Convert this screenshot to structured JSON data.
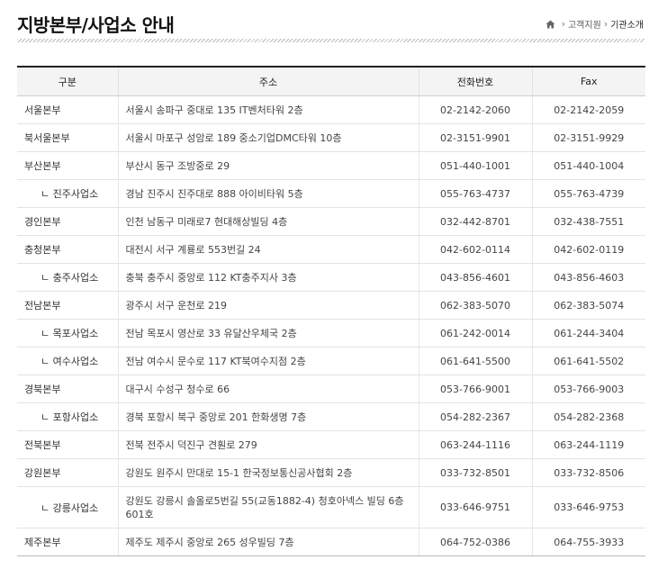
{
  "page_title": "지방본부/사업소 안내",
  "breadcrumb": {
    "home_icon": "home-icon",
    "items": [
      "고객지원",
      "기관소개"
    ]
  },
  "table": {
    "headers": [
      "구분",
      "주소",
      "전화번호",
      "Fax"
    ],
    "rows": [
      {
        "name": "서울본부",
        "address": "서울시 송파구 중대로 135 IT벤처타워 2층",
        "tel": "02-2142-2060",
        "fax": "02-2142-2059"
      },
      {
        "name": "북서울본부",
        "address": "서울시 마포구 성암로 189 중소기업DMC타워 10층",
        "tel": "02-3151-9901",
        "fax": "02-3151-9929"
      },
      {
        "name": "부산본부",
        "address": "부산시 동구 조방중로 29",
        "tel": "051-440-1001",
        "fax": "051-440-1004"
      },
      {
        "name": "ㄴ 진주사업소",
        "address": "경남 진주시 진주대로 888 아이비타워 5층",
        "tel": "055-763-4737",
        "fax": "055-763-4739"
      },
      {
        "name": "경인본부",
        "address": "인천 남동구 미래로7 현대해상빌딩 4층",
        "tel": "032-442-8701",
        "fax": "032-438-7551"
      },
      {
        "name": "충청본부",
        "address": "대전시 서구 계룡로 553번길 24",
        "tel": "042-602-0114",
        "fax": "042-602-0119"
      },
      {
        "name": "ㄴ 충주사업소",
        "address": "충북 충주시 중앙로 112 KT충주지사 3층",
        "tel": "043-856-4601",
        "fax": "043-856-4603"
      },
      {
        "name": "전남본부",
        "address": "광주시 서구 운천로 219",
        "tel": "062-383-5070",
        "fax": "062-383-5074"
      },
      {
        "name": "ㄴ 목포사업소",
        "address": "전남 목포시 영산로 33 유달산우체국 2층",
        "tel": "061-242-0014",
        "fax": "061-244-3404"
      },
      {
        "name": "ㄴ 여수사업소",
        "address": "전남 여수시 문수로 117 KT북여수지점 2층",
        "tel": "061-641-5500",
        "fax": "061-641-5502"
      },
      {
        "name": "경북본부",
        "address": "대구시 수성구 청수로 66",
        "tel": "053-766-9001",
        "fax": "053-766-9003"
      },
      {
        "name": "ㄴ 포항사업소",
        "address": "경북 포항시 북구 중앙로 201 한화생명 7층",
        "tel": "054-282-2367",
        "fax": "054-282-2368"
      },
      {
        "name": "전북본부",
        "address": "전북 전주시 덕진구 견훤로 279",
        "tel": "063-244-1116",
        "fax": "063-244-1119"
      },
      {
        "name": "강원본부",
        "address": "강원도 원주시 만대로 15-1 한국정보통신공사협회 2층",
        "tel": "033-732-8501",
        "fax": "033-732-8506"
      },
      {
        "name": "ㄴ 강릉사업소",
        "address": "강원도 강릉시 솔올로5번길 55(교동1882-4) 청호아넥스 빌딩 6층 601호",
        "tel": "033-646-9751",
        "fax": "033-646-9753"
      },
      {
        "name": "제주본부",
        "address": "제주도 제주시 중앙로 265 성우빌딩 7층",
        "tel": "064-752-0386",
        "fax": "064-755-3933"
      }
    ]
  }
}
